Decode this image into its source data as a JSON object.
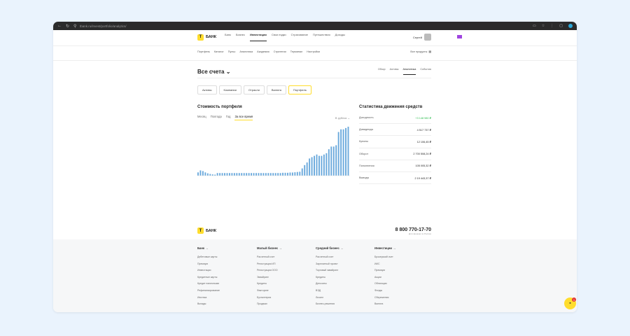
{
  "browser": {
    "url": "tbank.ru/invest/portfolio/analytics/"
  },
  "header": {
    "logo": "БАНК",
    "nav": [
      "Банк",
      "Бизнес",
      "Инвестиции",
      "Свои ездки",
      "Страхование",
      "Путешествия",
      "Доходы"
    ],
    "active_nav": "Инвестиции",
    "user": "Сергей"
  },
  "subnav": {
    "items": [
      "Портфель",
      "Каталог",
      "Пульс",
      "Аналитика",
      "Академия",
      "Стратегии",
      "Терминал",
      "Настройки"
    ],
    "right": "Все продукты"
  },
  "account": {
    "title": "Все счета ⌄",
    "tabs": [
      "Обзор",
      "Активы",
      "Аналитика",
      "События"
    ],
    "active_tab": "Аналитика"
  },
  "segments": {
    "items": [
      "Активы",
      "Компании",
      "Отрасли",
      "Валюта",
      "Портфель"
    ],
    "selected": "Портфель"
  },
  "chart_section": {
    "title": "Стоимость портфеля",
    "periods": [
      "Месяц",
      "Полгода",
      "Год",
      "За все время"
    ],
    "active_period": "За все время",
    "currency": "В рублях ⌄"
  },
  "chart_data": {
    "type": "bar",
    "values": [
      2.5,
      4,
      3.5,
      2.5,
      1.8,
      1.3,
      1,
      0.8,
      2,
      2,
      2,
      2,
      2,
      2,
      2,
      2,
      2,
      2,
      2,
      2,
      2,
      2,
      2,
      2,
      2,
      2,
      2,
      2,
      2,
      2,
      2,
      2,
      2,
      2,
      2,
      2.2,
      2.2,
      2.2,
      2.4,
      2.4,
      2.6,
      2.8,
      3,
      5.5,
      8,
      10,
      13,
      14,
      15,
      16,
      15,
      15,
      16,
      17,
      20,
      22,
      22,
      23,
      33,
      35,
      35,
      36,
      37
    ],
    "color": "#6aa9dc"
  },
  "stats": {
    "title": "Статистика движения средств",
    "rows": [
      {
        "label": "Доходность",
        "value": "+3 148 980 ₽",
        "positive": true
      },
      {
        "label": "Дивиденды",
        "value": "4 517 737 ₽",
        "positive": false
      },
      {
        "label": "Купоны",
        "value": "12 106,45 ₽",
        "positive": false
      },
      {
        "label": "Оборот",
        "value": "2 700 508,24 ₽",
        "positive": false
      },
      {
        "label": "Пополнения",
        "value": "105 005,32 ₽",
        "positive": false
      },
      {
        "label": "Выводы",
        "value": "2 19 443,37 ₽",
        "positive": false
      }
    ]
  },
  "footer": {
    "phone": "8 800 770-17-70",
    "phone_note": "Для звонков по России",
    "columns": [
      {
        "title": "Банк →",
        "items": [
          "Дебетовые карты",
          "Премиум",
          "Инвестиции",
          "Кредитные карты",
          "Кредит наличными",
          "Рефинансирование",
          "Ипотека",
          "Вклады"
        ]
      },
      {
        "title": "Малый бизнес →",
        "items": [
          "Расчетный счет",
          "Регистрация ИП",
          "Регистрация ООО",
          "Эквайринг",
          "Кредиты",
          "Факторинг",
          "Бухгалтерия",
          "Продажи"
        ]
      },
      {
        "title": "Средний бизнес →",
        "items": [
          "Расчетный счет",
          "Зарплатный проект",
          "Торговый эквайринг",
          "Кредиты",
          "Депозиты",
          "ВЭД",
          "Лизинг",
          "Бизнес-решения"
        ]
      },
      {
        "title": "Инвестиции →",
        "items": [
          "Брокерский счет",
          "ИИС",
          "Премиум",
          "Акции",
          "Облигации",
          "Фонды",
          "Сбережения",
          "Валюта"
        ]
      }
    ]
  },
  "chat": {
    "badge": "1"
  }
}
